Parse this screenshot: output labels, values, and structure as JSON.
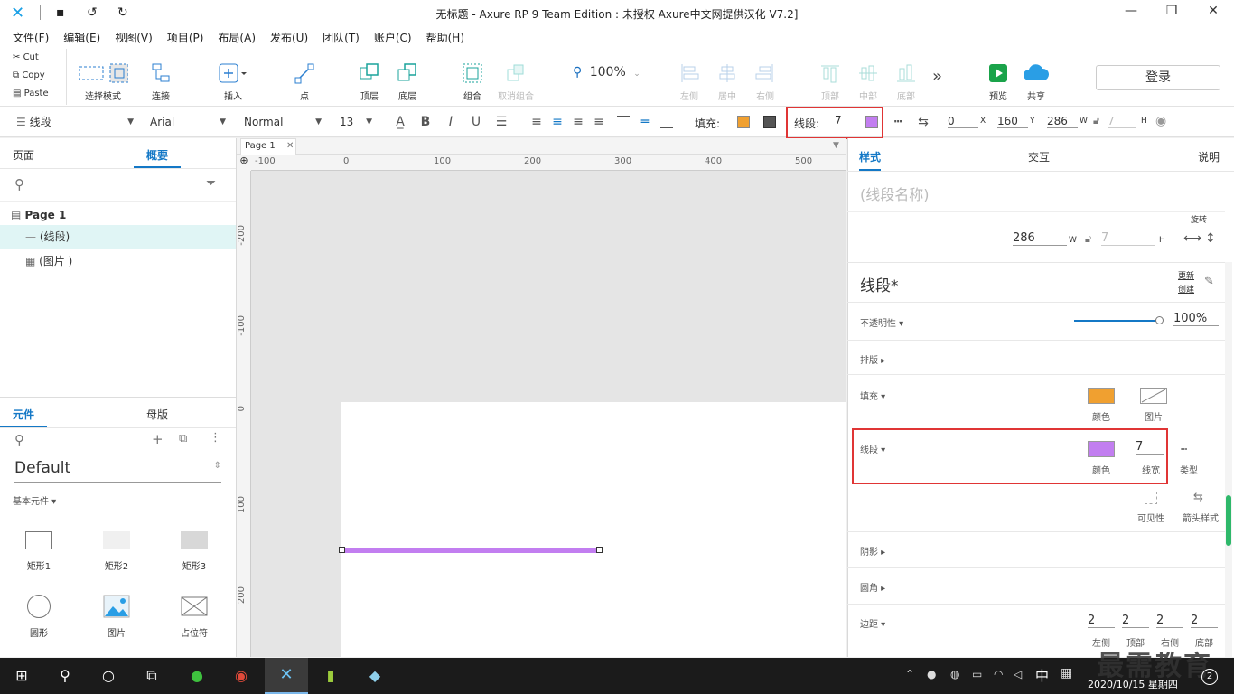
{
  "window": {
    "title": "无标题 - Axure RP 9 Team Edition : 未授权      Axure中文网提供汉化 V7.2]"
  },
  "menu": [
    "文件(F)",
    "编辑(E)",
    "视图(V)",
    "项目(P)",
    "布局(A)",
    "发布(U)",
    "团队(T)",
    "账户(C)",
    "帮助(H)"
  ],
  "clipboard": {
    "cut": "Cut",
    "copy": "Copy",
    "paste": "Paste"
  },
  "toolbar": {
    "select_mode": "选择模式",
    "connect": "连接",
    "insert": "插入",
    "point": "点",
    "front": "顶层",
    "back": "底层",
    "group": "组合",
    "ungroup": "取消组合",
    "zoom": "100%",
    "left": "左侧",
    "center": "居中",
    "right": "右侧",
    "top": "顶部",
    "middle": "中部",
    "bottom": "底部",
    "more": "»",
    "preview": "预览",
    "share": "共享",
    "login": "登录"
  },
  "format": {
    "widget_type": "线段",
    "font": "Arial",
    "style": "Normal",
    "size": "13",
    "fill_label": "填充:",
    "line_label": "线段:",
    "line_width": "7",
    "x": "0",
    "x_label": "X",
    "y": "160",
    "y_label": "Y",
    "w": "286",
    "w_label": "W",
    "h": "7",
    "h_label": "H",
    "fill_color": "#f0a030",
    "line_color": "#c27ef0"
  },
  "left": {
    "tab_pages": "页面",
    "tab_outline": "概要",
    "page_name": "Page 1",
    "outline_items": [
      "(线段)",
      "(图片 )"
    ],
    "tab_widgets": "元件",
    "tab_masters": "母版",
    "library": "Default",
    "category": "基本元件 ▾",
    "widgets": [
      "矩形1",
      "矩形2",
      "矩形3",
      "圆形",
      "图片",
      "占位符"
    ]
  },
  "canvas": {
    "tab": "Page 1",
    "ruler_h": [
      "-100",
      "0",
      "100",
      "200",
      "300",
      "400",
      "500"
    ],
    "ruler_v": [
      "-200",
      "-100",
      "0",
      "100",
      "200"
    ]
  },
  "right": {
    "tab_style": "样式",
    "tab_interact": "交互",
    "tab_notes": "说明",
    "name_placeholder": "(线段名称)",
    "rotate": "旋转",
    "w": "286",
    "w_label": "W",
    "h": "7",
    "h_label": "H",
    "style_name": "线段*",
    "update": "更新",
    "create": "创建",
    "opacity_label": "不透明性 ▾",
    "opacity_value": "100%",
    "typography_label": "排版 ▸",
    "fill_label": "填充 ▾",
    "fill_color_label": "颜色",
    "fill_image_label": "图片",
    "line_label": "线段 ▾",
    "line_color_label": "颜色",
    "line_width_label": "线宽",
    "line_width": "7",
    "line_type_label": "类型",
    "visible_label": "可见性",
    "arrow_label": "箭头样式",
    "shadow_label": "阴影 ▸",
    "corner_label": "圆角 ▸",
    "padding_label": "边距 ▾",
    "padding": [
      "2",
      "2",
      "2",
      "2"
    ],
    "padding_labels": [
      "左侧",
      "顶部",
      "右侧",
      "底部"
    ]
  },
  "taskbar": {
    "ime": "中",
    "datetime": "2020/10/15 星期四",
    "notif": "2",
    "watermark": "最需教育"
  }
}
